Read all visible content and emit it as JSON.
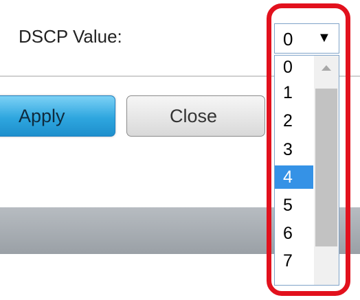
{
  "form": {
    "dscp_label": "DSCP Value:",
    "selected_value": "0",
    "options": [
      "0",
      "1",
      "2",
      "3",
      "4",
      "5",
      "6",
      "7"
    ],
    "highlighted_option": "4"
  },
  "buttons": {
    "apply_label": "Apply",
    "close_label": "Close"
  },
  "colors": {
    "highlight_border": "#e2111d",
    "selected_option": "#3592e6",
    "apply_button": "#2ea6df"
  },
  "icons": {
    "select_arrow": "triangle-down-icon",
    "scroll_up": "triangle-up-icon"
  }
}
